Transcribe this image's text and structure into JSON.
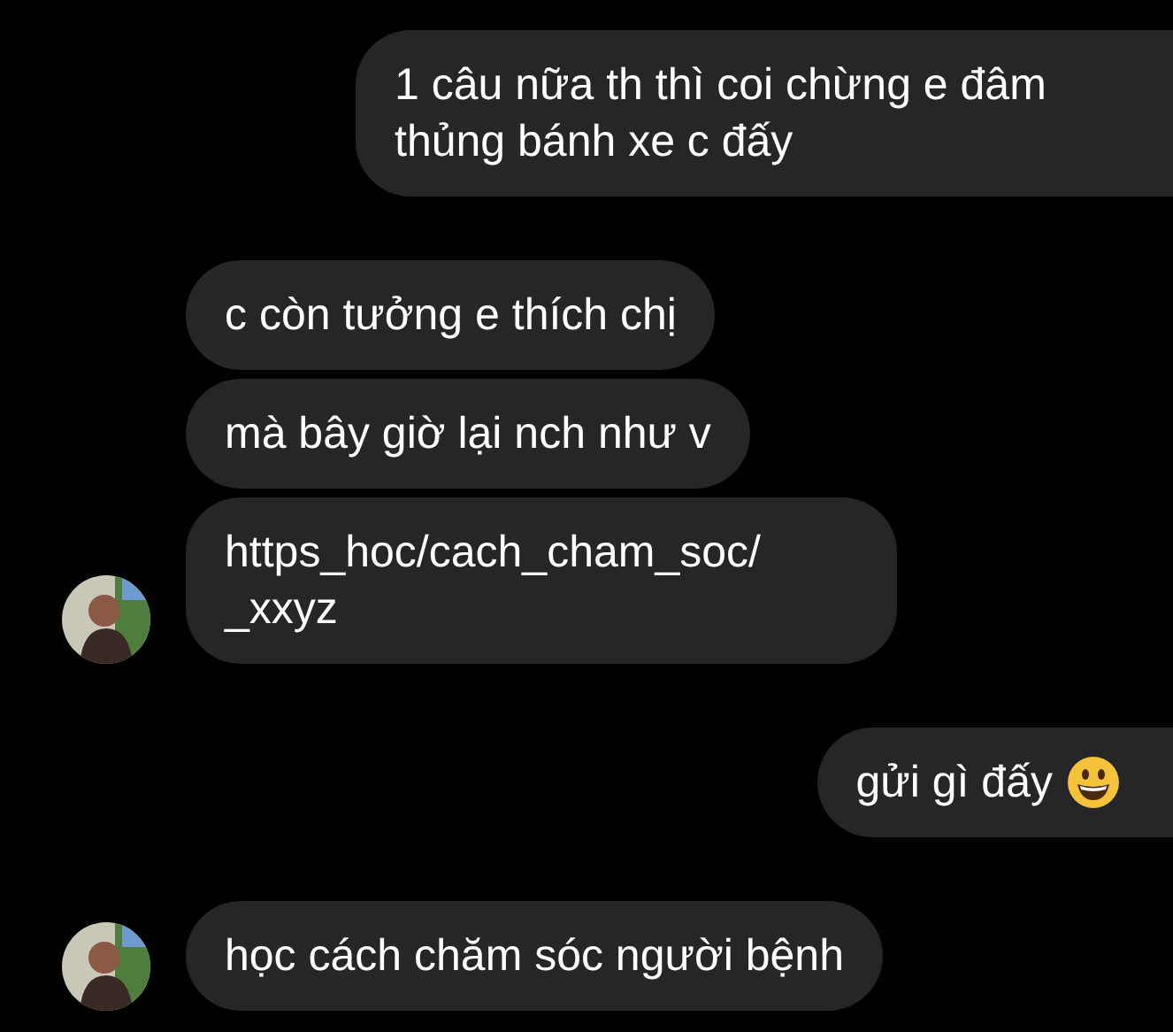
{
  "messages": [
    {
      "kind": "outgoing",
      "text": "1 câu nữa th thì coi chừng e đâm thủng bánh xe c đấy"
    },
    {
      "kind": "incoming",
      "text": "c còn tưởng e thích chị",
      "show_avatar": false
    },
    {
      "kind": "incoming",
      "text": "mà bây giờ lại nch như v",
      "show_avatar": false
    },
    {
      "kind": "incoming",
      "text": "https_hoc/cach_cham_soc/_xxyz",
      "show_avatar": true
    },
    {
      "kind": "outgoing",
      "text": "gửi gì đấy",
      "emoji": true
    },
    {
      "kind": "incoming",
      "text": "học cách chăm sóc người bệnh",
      "show_avatar": true
    }
  ]
}
